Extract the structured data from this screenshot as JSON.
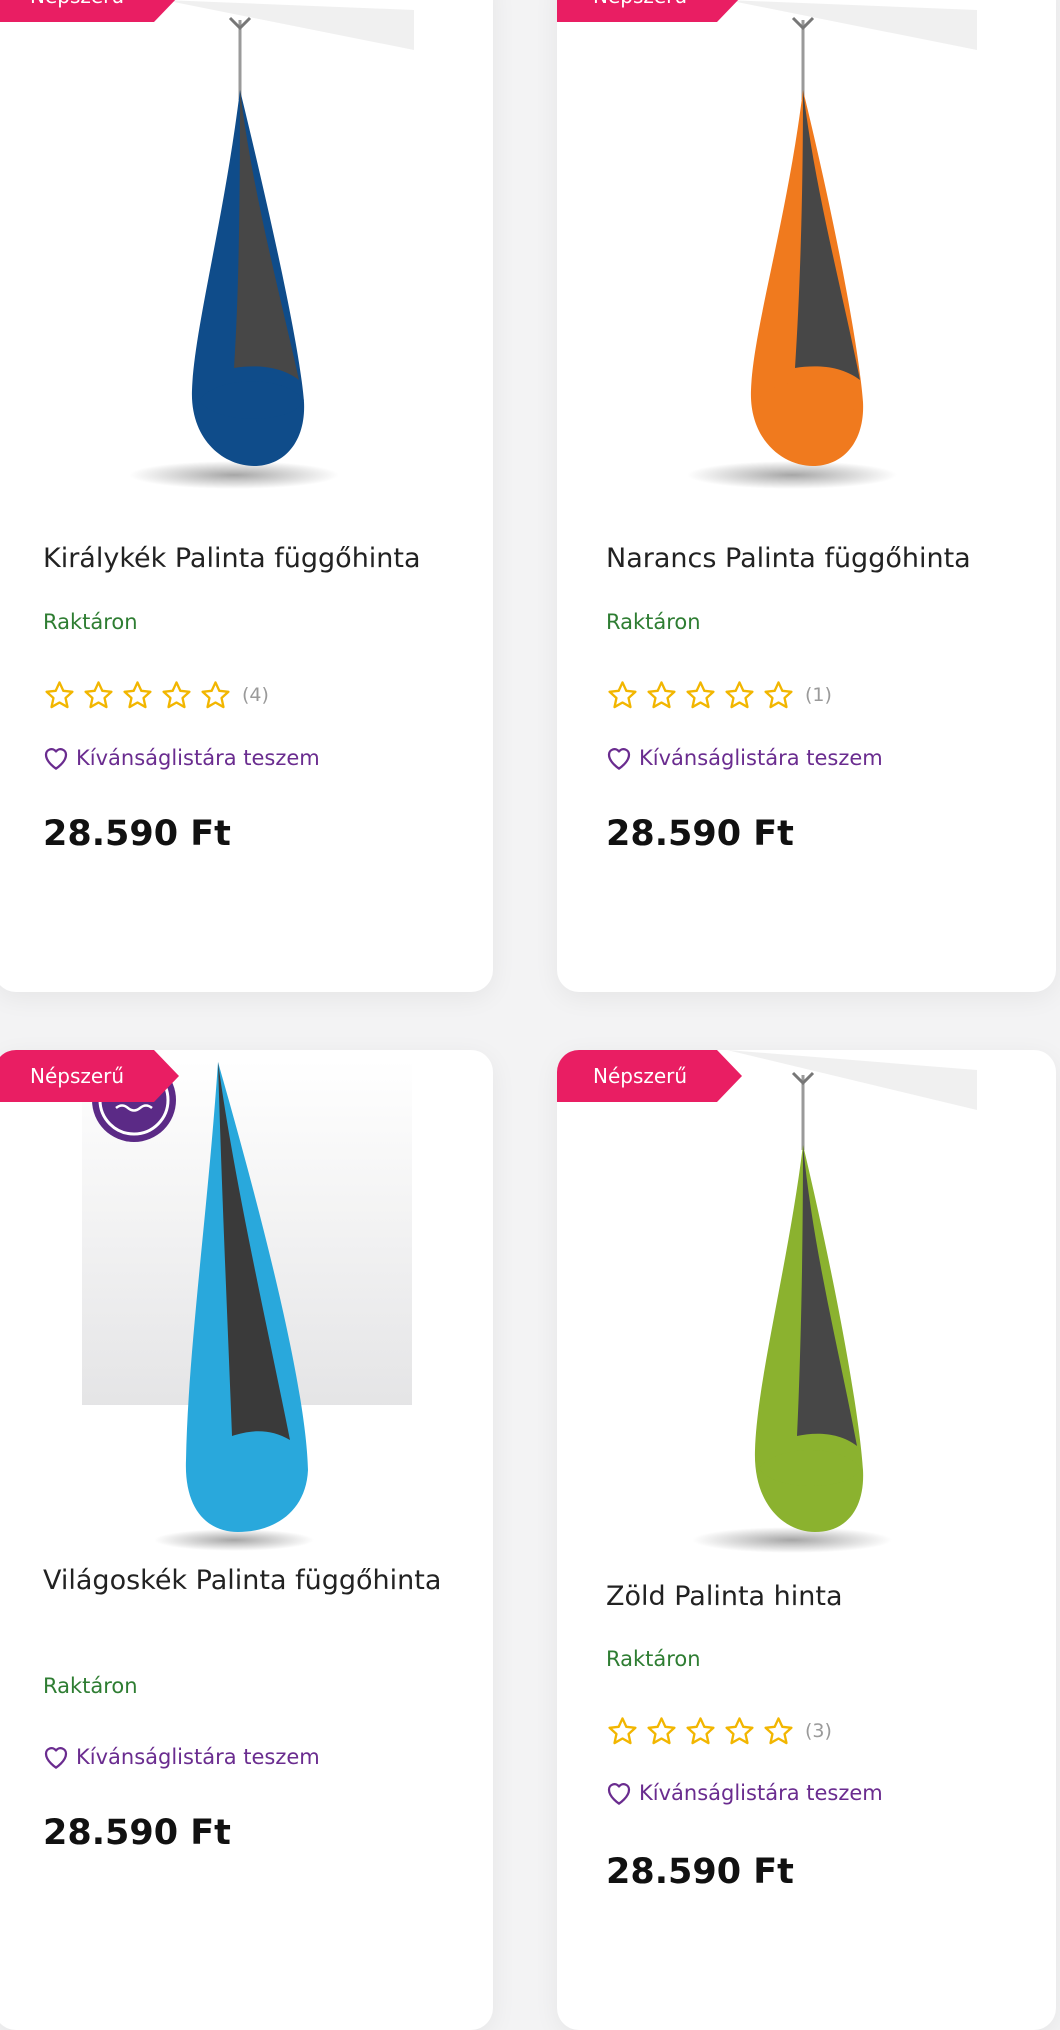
{
  "colors": {
    "badge_bg": "#e91e63",
    "stock_green": "#2e7d32",
    "star_yellow": "#f2b600",
    "wish_purple": "#6a2c8f",
    "text_dark": "#222222"
  },
  "products": [
    {
      "badge": "Népszerű",
      "name": "Királykék Palinta függőhinta",
      "stock": "Raktáron",
      "rating_count": "(4)",
      "stars_filled": 0,
      "wishlist": "Kívánságlistára teszem",
      "price": "28.590 Ft",
      "fabric_color": "#0f4c8a"
    },
    {
      "badge": "Népszerű",
      "name": "Narancs Palinta függőhinta",
      "stock": "Raktáron",
      "rating_count": "(1)",
      "stars_filled": 0,
      "wishlist": "Kívánságlistára teszem",
      "price": "28.590 Ft",
      "fabric_color": "#f07a1e"
    },
    {
      "badge": "Népszerű",
      "name": "Világoskék Palinta függőhinta",
      "stock": "Raktáron",
      "wishlist": "Kívánságlistára teszem",
      "price": "28.590 Ft",
      "fabric_color": "#29a8dc"
    },
    {
      "badge": "Népszerű",
      "name": "Zöld Palinta hinta",
      "stock": "Raktáron",
      "rating_count": "(3)",
      "stars_filled": 0,
      "wishlist": "Kívánságlistára teszem",
      "price": "28.590 Ft",
      "fabric_color": "#8bb22f"
    }
  ],
  "icons": {
    "star": "star-outline-icon",
    "wishlist": "heart-outline-icon",
    "water_badge": "water-waves-icon"
  }
}
